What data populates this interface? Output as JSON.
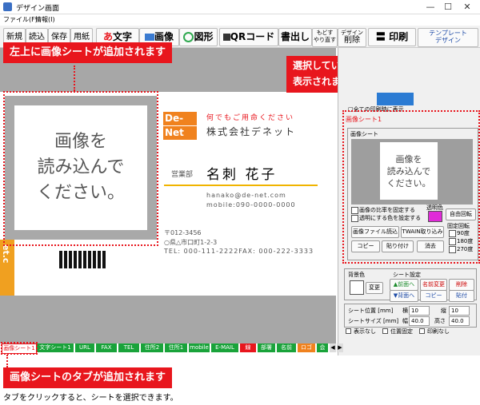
{
  "window": {
    "title": "デザイン画面",
    "minimize": "—",
    "maximize": "☐",
    "close": "✕"
  },
  "menu": [
    "ファイル(F)",
    "情報(I)"
  ],
  "toolbar": {
    "new": "新規",
    "open": "読込",
    "save": "保存",
    "print_paper": "用紙",
    "text": "文字",
    "text_glyph": "あ",
    "image": "画像",
    "shape": "図形",
    "qr": "QRコード",
    "writeout": "書出し",
    "undo_line1": "もどす",
    "undo_line2": "やり直す",
    "delete_line1": "デザイン",
    "delete_line2": "削除",
    "print": "印刷",
    "template_line1": "テンプレート",
    "template_line2": "デザイン"
  },
  "card": {
    "image_placeholder_line1": "画像を",
    "image_placeholder_line2": "読み込んで",
    "image_placeholder_line3": "ください。",
    "logo_line1": "De-",
    "logo_line2": "Net",
    "tagline": "何でもご用命ください",
    "company": "株式会社デネット",
    "dept": "営業部",
    "name": "名刺 花子",
    "email": "hanako@de-net.com",
    "mobile": "mobile:090-0000-0000",
    "postal": "〒012-3456",
    "address": "○県△市口町1-2-3",
    "tel_fax": "TEL: 000-111-2222FAX: 000-222-3333",
    "side_text": "et.c"
  },
  "callouts": {
    "top_left": "左上に画像シートが追加されます",
    "right": "選択しているシートの設定内容が",
    "right_line2": "表示されます",
    "bottom": "画像シートのタブが追加されます",
    "bottom_caption": "タブをクリックすると、シートを選択できます。"
  },
  "panel": {
    "partial_label": "□全ての印刷時に表示",
    "sheet_group": "画像シート1",
    "sub_group": "画像シート",
    "preview_line1": "画像を",
    "preview_line2": "読み込んで",
    "preview_line3": "ください。",
    "keep_ratio": "画像の比率を固定する",
    "transparent_color": "透明にする色を設定する",
    "transparent_label": "透明色",
    "free_rotate": "自由回転",
    "load_image": "画像ファイル読込",
    "twain": "TWAIN取り込み",
    "fixed_rotate": "固定回転",
    "deg90": "90度",
    "deg180": "180度",
    "deg270": "270度",
    "copy": "コピー",
    "paste": "貼り付け",
    "erase": "消去",
    "bg_color": "背景色",
    "change": "変更",
    "sheet_settings": "シート設定",
    "front": "▲前面へ",
    "rename": "名前変更",
    "remove": "削除",
    "back": "▼背面へ",
    "copy2": "コピー",
    "paste2": "貼付",
    "pos_label": "シート位置 [mm]",
    "x_label": "横",
    "x_value": "10",
    "y_label": "縦",
    "y_value": "10",
    "size_label": "シートサイズ [mm]",
    "w_label": "幅",
    "w_value": "40.0",
    "h_label": "高さ",
    "h_value": "40.0",
    "hide": "表示なし",
    "lock_pos": "位置固定",
    "no_print": "印刷なし"
  },
  "tabs": [
    "画像シート1",
    "文字シート1",
    "URL",
    "FAX",
    "TEL",
    "住所2",
    "住所1",
    "mobile",
    "E-MAIL",
    "線",
    "部署",
    "名前",
    "ロゴ",
    "会"
  ],
  "colors": {
    "accent_red": "#e8161d",
    "tab_green": "#19a33a",
    "logo_orange": "#f0821e",
    "rule_yellow": "#f0b400"
  }
}
